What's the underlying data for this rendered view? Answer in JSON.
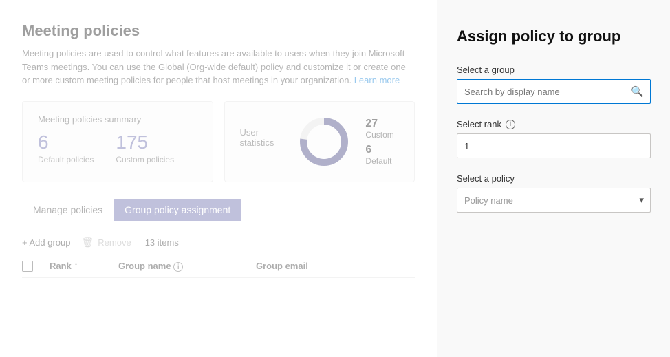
{
  "main": {
    "title": "Meeting policies",
    "description": "Meeting policies are used to control what features are available to users when they join Microsoft Teams meetings. You can use the Global (Org-wide default) policy and customize it or create one or more custom meeting policies for people that host meetings in your organization.",
    "learn_more": "Learn more",
    "summary_card": {
      "title": "Meeting policies summary",
      "default_count": "6",
      "default_label": "Default policies",
      "custom_count": "175",
      "custom_label": "Custom policies"
    },
    "user_stats_card": {
      "title": "User statistics",
      "custom_value": "27",
      "custom_label": "Custom",
      "default_value": "6",
      "default_label": "Default"
    },
    "tabs": [
      {
        "label": "Manage policies",
        "active": false
      },
      {
        "label": "Group policy assignment",
        "active": true
      }
    ],
    "toolbar": {
      "add_label": "+ Add group",
      "remove_label": "Remove",
      "items_count": "13 items"
    },
    "table": {
      "col_rank": "Rank",
      "col_group_name": "Group name",
      "col_group_email": "Group email"
    }
  },
  "panel": {
    "title": "Assign policy to group",
    "select_group_label": "Select a group",
    "search_placeholder": "Search by display name",
    "select_rank_label": "Select rank",
    "rank_value": "1",
    "rank_info": "i",
    "select_policy_label": "Select a policy",
    "policy_placeholder": "Policy name"
  }
}
